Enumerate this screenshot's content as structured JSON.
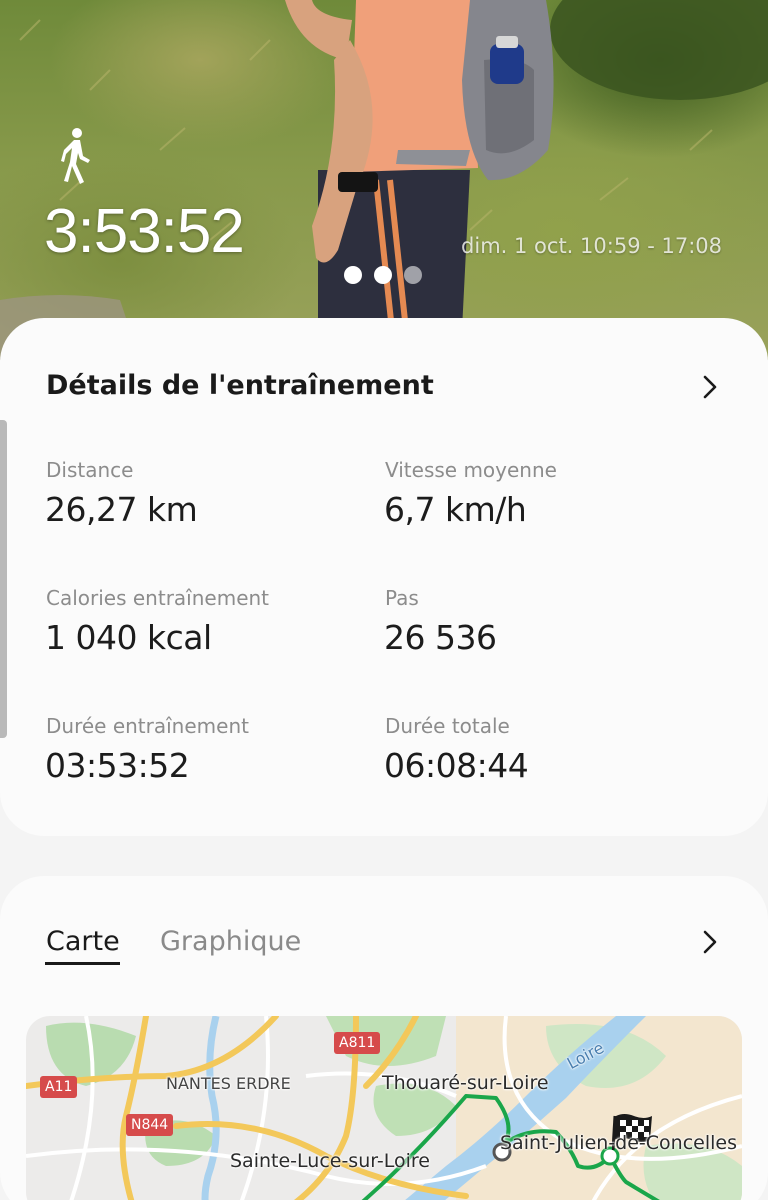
{
  "hero": {
    "activity_icon": "walking-person-icon",
    "duration": "3:53:52",
    "date_range": "dim. 1 oct. 10:59 - 17:08",
    "page_dots": 3,
    "active_dot": 1
  },
  "details": {
    "title": "Détails de l'entraînement",
    "stats": [
      {
        "label": "Distance",
        "value": "26,27 km"
      },
      {
        "label": "Vitesse moyenne",
        "value": "6,7 km/h"
      },
      {
        "label": "Calories entraînement",
        "value": "1 040 kcal"
      },
      {
        "label": "Pas",
        "value": "26 536"
      },
      {
        "label": "Durée entraînement",
        "value": "03:53:52"
      },
      {
        "label": "Durée totale",
        "value": "06:08:44"
      }
    ]
  },
  "map_section": {
    "tabs": [
      {
        "label": "Carte",
        "active": true
      },
      {
        "label": "Graphique",
        "active": false
      }
    ],
    "place_labels": {
      "nantes_erdre": "NANTES ERDRE",
      "thouare": "Thouaré-sur-Loire",
      "saint_julien": "Saint-Julien-de-Concelles",
      "sainte_luce": "Sainte-Luce-sur-Loire",
      "loire": "Loire"
    },
    "road_shields": {
      "a11": "A11",
      "a811": "A811",
      "n844": "N844"
    },
    "route_color": "#1aa64a"
  }
}
